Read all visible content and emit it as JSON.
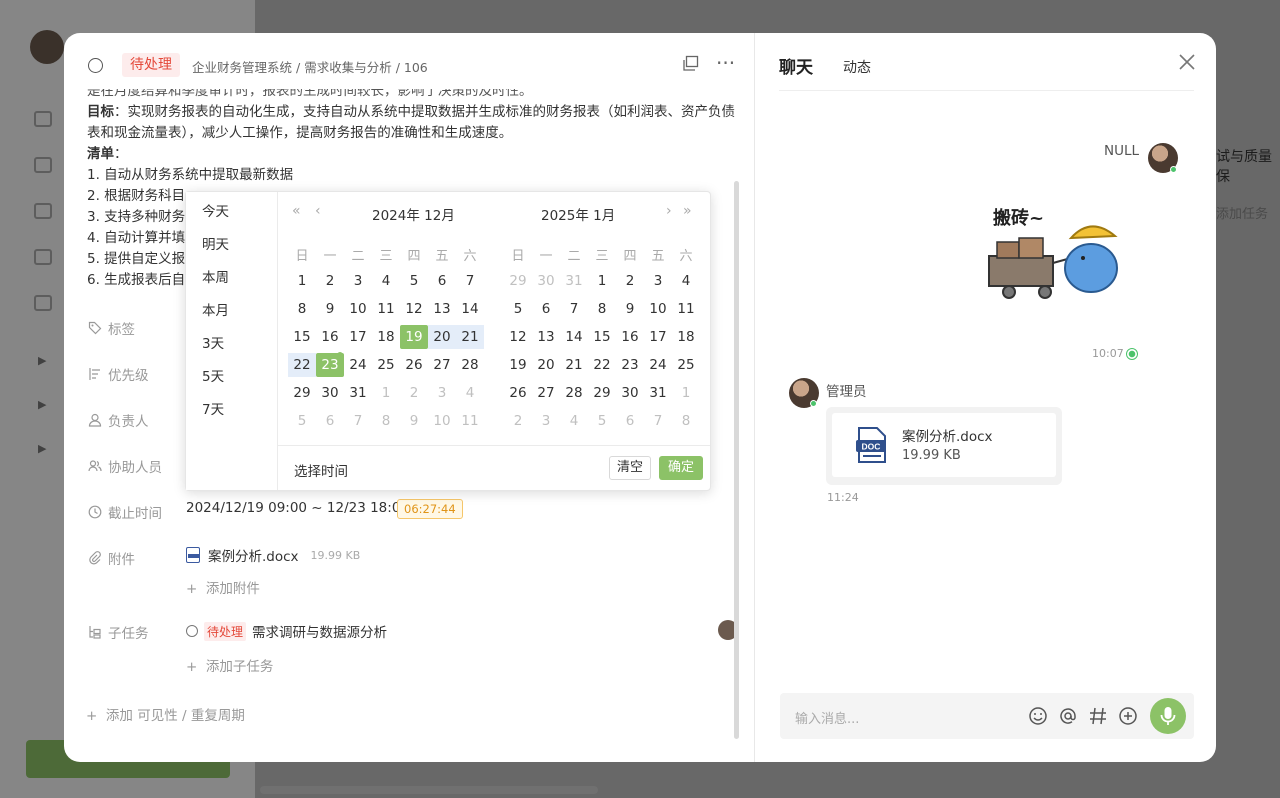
{
  "task": {
    "status": "待处理",
    "breadcrumb": [
      "企业财务管理系统",
      "/",
      "需求收集与分析",
      "/",
      "106"
    ],
    "desc_line0": "是在月度结算和季度审计时，报表的生成时间较长，影响了决策的及时性。",
    "goal_label": "目标",
    "goal_text": "：实现财务报表的自动化生成，支持自动从系统中提取数据并生成标准的财务报表（如利润表、资产负债表和现金流量表），减少人工操作，提高财务报告的准确性和生成速度。",
    "list_label": "清单",
    "list_colon": "：",
    "list": [
      "1. 自动从财务系统中提取最新数据",
      "2. 根据财务科目",
      "3. 支持多种财务",
      "4. 自动计算并填",
      "5. 提供自定义报",
      "6. 生成报表后自"
    ],
    "fields": {
      "tags": "标签",
      "priority": "优先级",
      "owner": "负责人",
      "assist": "协助人员",
      "deadline": "截止时间",
      "attachment": "附件",
      "subtask": "子任务"
    },
    "deadline_value": "2024/12/19 09:00 ~ 12/23 18:00",
    "countdown": "06:27:44",
    "attachment_name": "案例分析.docx",
    "attachment_size": "19.99 KB",
    "add_attachment": "添加附件",
    "subtask_status": "待处理",
    "subtask_name": "需求调研与数据源分析",
    "add_subtask": "添加子任务",
    "footer_add": "添加 可见性 / 重复周期"
  },
  "picker": {
    "shortcuts": [
      "今天",
      "明天",
      "本周",
      "本月",
      "3天",
      "5天",
      "7天"
    ],
    "left_title": "2024年 12月",
    "right_title": "2025年 1月",
    "weekdays": [
      "日",
      "一",
      "二",
      "三",
      "四",
      "五",
      "六"
    ],
    "left_days": [
      [
        "1",
        "2",
        "3",
        "4",
        "5",
        "6",
        "7"
      ],
      [
        "8",
        "9",
        "10",
        "11",
        "12",
        "13",
        "14"
      ],
      [
        "15",
        "16",
        "17",
        "18",
        "19",
        "20",
        "21"
      ],
      [
        "22",
        "23",
        "24",
        "25",
        "26",
        "27",
        "28"
      ],
      [
        "29",
        "30",
        "31",
        "1",
        "2",
        "3",
        "4"
      ],
      [
        "5",
        "6",
        "7",
        "8",
        "9",
        "10",
        "11"
      ]
    ],
    "right_days": [
      [
        "29",
        "30",
        "31",
        "1",
        "2",
        "3",
        "4"
      ],
      [
        "5",
        "6",
        "7",
        "8",
        "9",
        "10",
        "11"
      ],
      [
        "12",
        "13",
        "14",
        "15",
        "16",
        "17",
        "18"
      ],
      [
        "19",
        "20",
        "21",
        "22",
        "23",
        "24",
        "25"
      ],
      [
        "26",
        "27",
        "28",
        "29",
        "30",
        "31",
        "1"
      ],
      [
        "2",
        "3",
        "4",
        "5",
        "6",
        "7",
        "8"
      ]
    ],
    "select_time": "选择时间",
    "clear": "清空",
    "confirm": "确定"
  },
  "chat": {
    "tab_chat": "聊天",
    "tab_activity": "动态",
    "sender1": "NULL",
    "sticker_text": "搬砖~",
    "time1": "10:07",
    "sender2": "管理员",
    "file_name": "案例分析.docx",
    "file_size": "19.99 KB",
    "time2": "11:24",
    "input_placeholder": "输入消息..."
  },
  "background": {
    "right_text1": "试与质量保",
    "right_text2": "添加任务"
  },
  "colors": {
    "accent": "#8cc267",
    "status_red": "#e4493a",
    "countdown": "#e09418"
  }
}
